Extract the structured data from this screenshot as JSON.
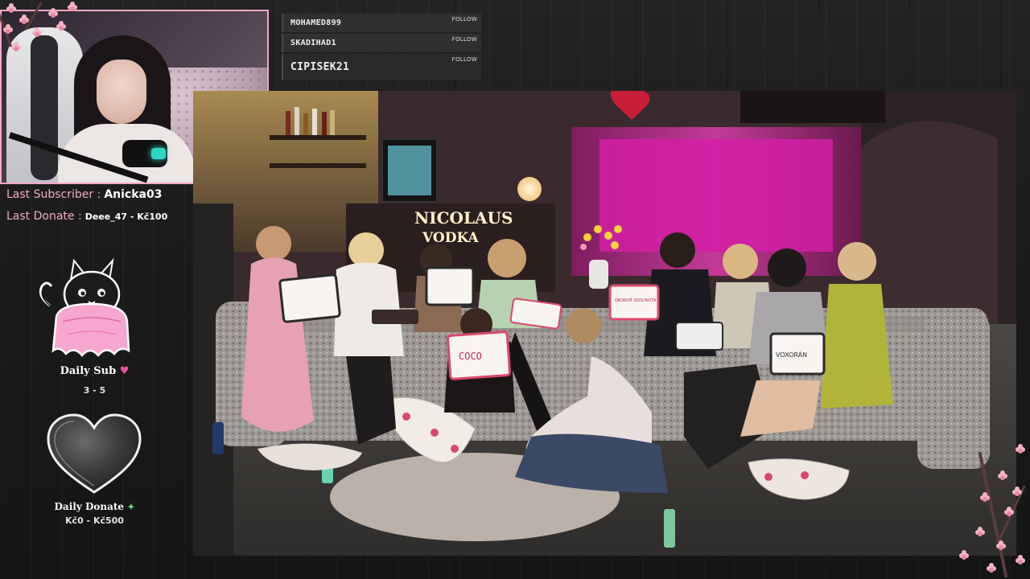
{
  "followers": {
    "entries": [
      {
        "name": "MOHAMED899",
        "action": "FOLLOW"
      },
      {
        "name": "SKADIHAD1",
        "action": "FOLLOW"
      },
      {
        "name": "CIPISEK21",
        "action": "FOLLOW"
      }
    ]
  },
  "stream_info": {
    "last_subscriber_label": "Last Subscriber :",
    "last_subscriber_value": "Anicka03",
    "last_donate_label": "Last Donate :",
    "last_donate_value": "Deee_47 - Kč100"
  },
  "goals": {
    "daily_sub": {
      "title": "Daily Sub",
      "progress_text": "3 - 5",
      "current": 3,
      "target": 5
    },
    "daily_donate": {
      "title": "Daily Donate",
      "progress_text": "Kč0 - Kč500",
      "current": 0,
      "target": 500
    }
  },
  "video": {
    "neon_sign_top": "NICOLAUS",
    "neon_sign_bottom": "VODKA",
    "boards": [
      "COCO",
      "OKOROŘ ODSUNUTA",
      "VOXORÁN"
    ]
  },
  "colors": {
    "accent_pink": "#f4a8c8",
    "neon_wall": "#d21fa6",
    "panel_bg": "#1b1b1b"
  }
}
